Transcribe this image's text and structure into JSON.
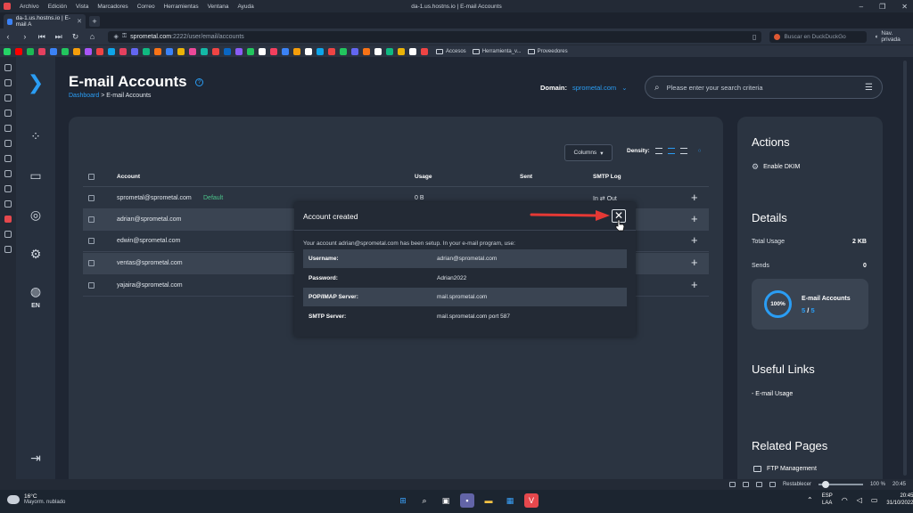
{
  "os_menu": {
    "items": [
      "Archivo",
      "Edición",
      "Vista",
      "Marcadores",
      "Correo",
      "Herramientas",
      "Ventana",
      "Ayuda"
    ],
    "window_title": "da-1.us.hostns.io | E-mail Accounts"
  },
  "browser": {
    "tab_title": "da-1.us.hostns.io | E-mail A",
    "url_host": "sprometal.com",
    "url_path": ":2222/user/email/accounts",
    "search_placeholder": "Buscar en DuckDuckGo",
    "private_label": "Nav. privada",
    "bookmark_folders": [
      "Accesos",
      "Herramienta_v...",
      "Proveedores"
    ],
    "bookmark_icon_colors": [
      "#25d366",
      "#ff0000",
      "#1db954",
      "#e4405f",
      "#3b82f6",
      "#22c55e",
      "#f59e0b",
      "#a855f7",
      "#ef4444",
      "#0ea5e9",
      "#e4405f",
      "#6366f1",
      "#10b981",
      "#f97316",
      "#3b82f6",
      "#eab308",
      "#ec4899",
      "#14b8a6",
      "#ef4444",
      "#0a66c2",
      "#8b5cf6",
      "#22c55e",
      "#ffffff",
      "#f43f5e",
      "#3b82f6",
      "#f59e0b",
      "#ffffff",
      "#0ea5e9",
      "#ef4444",
      "#22c55e",
      "#6366f1",
      "#f97316",
      "#ffffff",
      "#10b981",
      "#eab308",
      "#ffffff",
      "#ef4444"
    ],
    "zoom_reset": "Restablecer",
    "zoom": "100 %",
    "status_time": "20:45"
  },
  "nav": {
    "lang": "EN"
  },
  "page": {
    "title": "E-mail Accounts",
    "breadcrumb_home": "Dashboard",
    "breadcrumb_sep": ">",
    "breadcrumb_current": "E-mail Accounts",
    "domain_label": "Domain:",
    "domain_value": "sprometal.com",
    "search_placeholder": "Please enter your search criteria"
  },
  "table": {
    "columns_button": "Columns",
    "density_label": "Density:",
    "headers": {
      "account": "Account",
      "usage": "Usage",
      "sent": "Sent",
      "smtp": "SMTP Log"
    },
    "rows": [
      {
        "account": "sprometal@sprometal.com",
        "badge": "Default",
        "usage": "0 B",
        "smtp": "In ⇄ Out"
      },
      {
        "account": "adrian@sprometal.com",
        "badge": "",
        "usage": "",
        "smtp": ""
      },
      {
        "account": "edwin@sprometal.com",
        "badge": "",
        "usage": "",
        "smtp": ""
      },
      {
        "account": "ventas@sprometal.com",
        "badge": "",
        "usage": "",
        "smtp": ""
      },
      {
        "account": "yajaira@sprometal.com",
        "badge": "",
        "usage": "",
        "smtp": ""
      }
    ]
  },
  "modal": {
    "title": "Account created",
    "intro": "Your account adrian@sprometal.com has been setup. In your e-mail program, use:",
    "rows": [
      {
        "key": "Username:",
        "value": "adrian@sprometal.com"
      },
      {
        "key": "Password:",
        "value": "Adrian2022"
      },
      {
        "key": "POP/IMAP Server:",
        "value": "mail.sprometal.com"
      },
      {
        "key": "SMTP Server:",
        "value": "mail.sprometal.com port 587"
      }
    ]
  },
  "side": {
    "actions_title": "Actions",
    "enable_dkim": "Enable DKIM",
    "details_title": "Details",
    "total_usage_label": "Total Usage",
    "total_usage_value": "2 KB",
    "sends_label": "Sends",
    "sends_value": "0",
    "ring_percent": "100%",
    "email_accounts_label": "E-mail Accounts",
    "accounts_used": "5",
    "accounts_sep": "/",
    "accounts_total": "5",
    "useful_links_title": "Useful Links",
    "email_usage_link": "- E-mail Usage",
    "related_title": "Related Pages",
    "ftp_link": "FTP Management"
  },
  "taskbar": {
    "temp": "16°C",
    "weather": "Mayorm. nublado",
    "lang_line1": "ESP",
    "lang_line2": "LAA",
    "time": "20:45",
    "date": "31/10/2022"
  },
  "colors": {
    "accent": "#2a9df4",
    "default_badge": "#4cc38a",
    "arrow": "#e53935"
  }
}
